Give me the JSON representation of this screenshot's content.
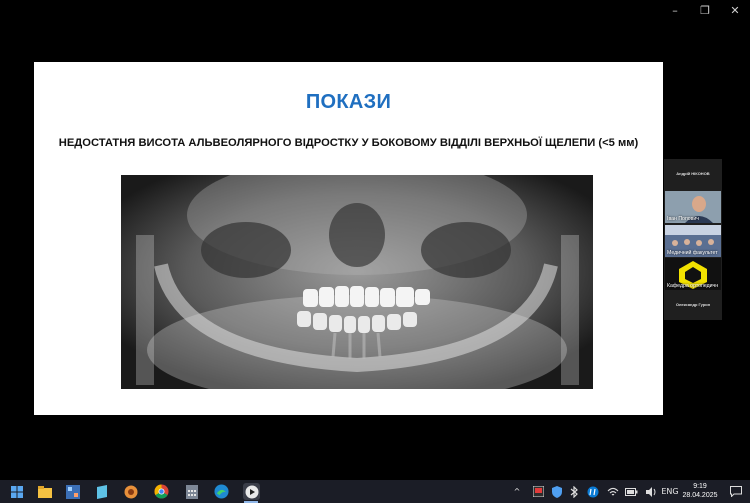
{
  "window": {
    "minimize": "–",
    "maximize": "❐",
    "close": "✕"
  },
  "slide": {
    "title": "ПОКАЗИ",
    "subtitle": "НЕДОСТАТНЯ ВИСОТА АЛЬВЕОЛЯРНОГО ВІДРОСТКУ У БОКОВОМУ ВІДДІЛІ ВЕРХНЬОЇ ЩЕЛЕПИ (<5 мм)"
  },
  "participants": {
    "top_name": "Андрій НІКОНОВ",
    "tiles": [
      {
        "label": "Іван Попович"
      },
      {
        "label": "Медичний факультет"
      },
      {
        "label": "Кафедра ортопедичн"
      }
    ],
    "bottom_name": "Олександр Гурин"
  },
  "taskbar": {
    "language": "ENG",
    "time": "9:19",
    "date": "28.04.2025",
    "tray_chevron": "^"
  },
  "colors": {
    "title_blue": "#1f6fc0",
    "taskbar": "#1b1d26"
  }
}
